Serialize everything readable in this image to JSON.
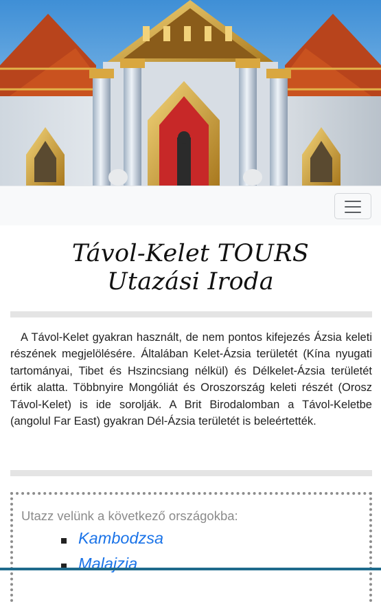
{
  "hero": {
    "alt": "temple-banner"
  },
  "navbar": {
    "toggle_icon": "hamburger-icon"
  },
  "title": {
    "line1": "Távol-Kelet TOURS",
    "line2": "Utazási Iroda"
  },
  "intro": {
    "text": "A Távol-Kelet gyakran használt, de nem pontos kifejezés Ázsia keleti részének megjelölésére. Általában Kelet-Ázsia területét (Kína nyugati tartományai, Tibet és Hszincsiang nélkül) és Délkelet-Ázsia területét értik alatta. Többnyire Mongóliát és Oroszország keleti részét (Orosz Távol-Kelet) is ide sorolják. A Brit Birodalomban a Távol-Keletbe (angolul Far East) gyakran Dél-Ázsia területét is beleértették."
  },
  "countries": {
    "intro": "Utazz velünk a következő országokba:",
    "items": [
      {
        "label": "Kambodzsa"
      },
      {
        "label": "Malajzia"
      }
    ]
  },
  "colors": {
    "link": "#1a73e8",
    "muted": "#8b8b8b",
    "divider": "#e4e4e4",
    "navbar_bg": "#f8f9fa"
  }
}
